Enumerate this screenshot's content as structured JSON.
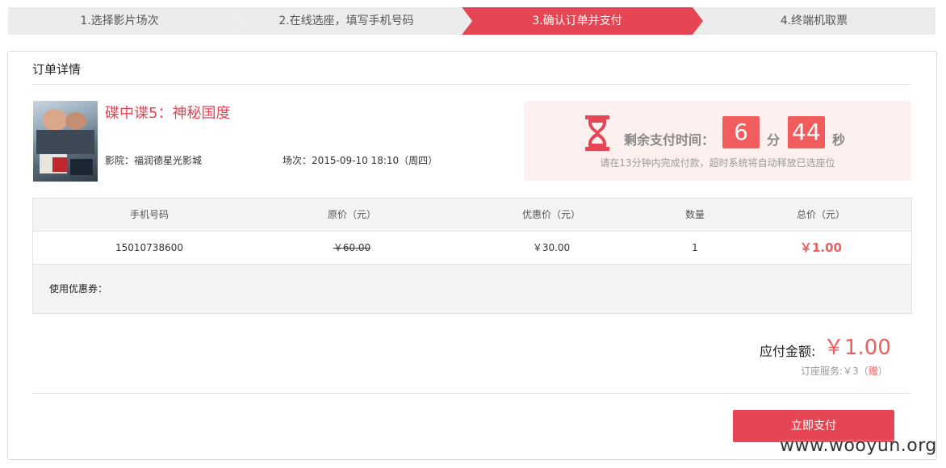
{
  "steps": [
    {
      "label": "1.选择影片场次",
      "active": false
    },
    {
      "label": "2.在线选座，填写手机号码",
      "active": false
    },
    {
      "label": "3.确认订单并支付",
      "active": true
    },
    {
      "label": "4.终端机取票",
      "active": false
    }
  ],
  "order": {
    "title": "订单详情",
    "movie_title": "碟中谍5：神秘国度",
    "cinema": "影院：福润德星光影城",
    "session": "场次：2015-09-10 18:10（周四）"
  },
  "countdown": {
    "label": "剩余支付时间：",
    "minutes": "6",
    "minutes_unit": "分",
    "seconds": "44",
    "seconds_unit": "秒",
    "hint": "请在13分钟内完成付款，超时系统将自动释放已选座位"
  },
  "table": {
    "headers": [
      "手机号码",
      "原价（元）",
      "优惠价（元）",
      "数量",
      "总价（元）"
    ],
    "row": {
      "phone": "15010738600",
      "original_price": "￥60.00",
      "discount_price": "￥30.00",
      "quantity": "1",
      "total": "￥1.00"
    },
    "coupon_label": "使用优惠券："
  },
  "summary": {
    "pay_label": "应付金额:",
    "pay_amount": "￥1.00",
    "service_prefix": "订座服务:￥3（",
    "service_free": "赠",
    "service_suffix": "）"
  },
  "pay_button": "立即支付",
  "watermark": "www.wooyun.org",
  "colors": {
    "accent": "#e64654",
    "price_red": "#f15c5c",
    "step_bg": "#ececec"
  }
}
